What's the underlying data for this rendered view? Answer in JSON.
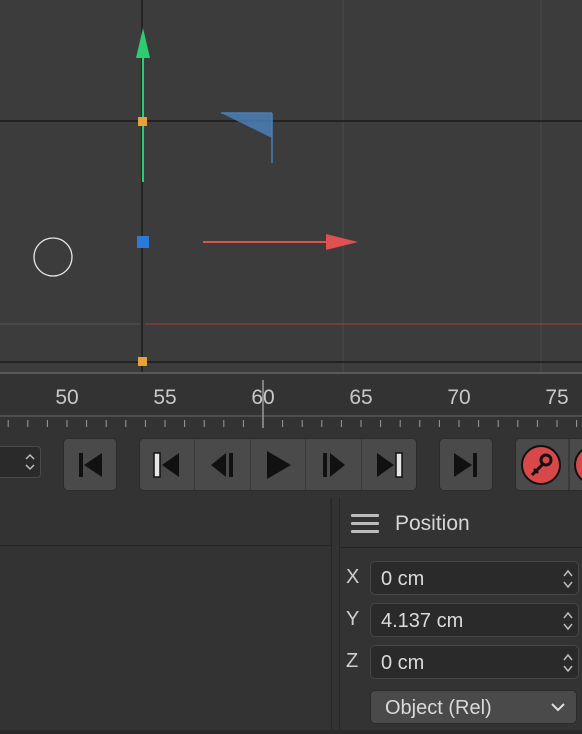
{
  "colors": {
    "viewport_bg": "#3c3c3c",
    "y_axis": "#2ecc71",
    "x_axis": "#e05050",
    "selection_blue": "#2a7bd8",
    "handle_orange": "#e8a03a",
    "record_red": "#d94848"
  },
  "viewport": {
    "icons": [
      "move-gizmo-icon",
      "y-axis-arrow-icon",
      "x-axis-arrow-icon",
      "rotation-circle-icon",
      "plane-handle-icon"
    ]
  },
  "timeline": {
    "ticks": [
      "50",
      "55",
      "60",
      "65",
      "70",
      "75"
    ],
    "current_frame": 60
  },
  "transport": {
    "buttons": [
      {
        "name": "go-to-start-button",
        "icon": "skip-start-icon"
      },
      {
        "name": "previous-key-button",
        "icon": "prev-key-icon"
      },
      {
        "name": "previous-frame-button",
        "icon": "prev-frame-icon"
      },
      {
        "name": "play-button",
        "icon": "play-icon"
      },
      {
        "name": "next-frame-button",
        "icon": "next-frame-icon"
      },
      {
        "name": "next-key-button",
        "icon": "next-key-icon"
      },
      {
        "name": "go-to-end-button",
        "icon": "skip-end-icon"
      },
      {
        "name": "record-keys-button",
        "icon": "record-key-icon"
      }
    ]
  },
  "coordinates": {
    "title": "Position",
    "fields": [
      {
        "axis": "X",
        "value": "0 cm"
      },
      {
        "axis": "Y",
        "value": "4.137 cm"
      },
      {
        "axis": "Z",
        "value": "0 cm"
      }
    ],
    "mode": "Object (Rel)"
  }
}
